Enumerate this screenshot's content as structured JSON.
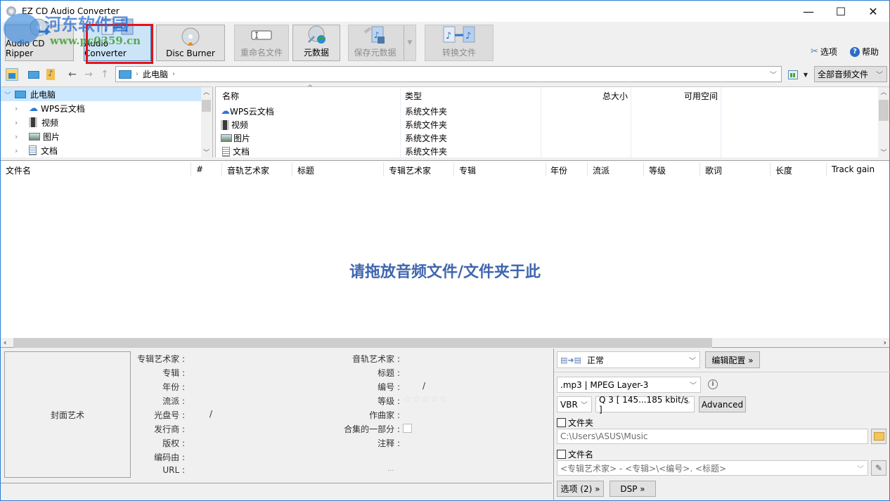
{
  "window": {
    "title": "EZ CD Audio Converter",
    "controls": {
      "minimize": "—",
      "maximize": "☐",
      "close": "✕"
    }
  },
  "watermark": {
    "text": "河东软件园",
    "url": "www.pc0359.cn"
  },
  "ribbon": {
    "buttons": [
      {
        "label": "Audio CD Ripper",
        "icon": "cd-ripper-icon",
        "state": "normal"
      },
      {
        "label": "Audio Converter",
        "icon": "audio-converter-icon",
        "state": "active"
      },
      {
        "label": "Disc Burner",
        "icon": "disc-burner-icon",
        "state": "normal"
      },
      {
        "label": "重命名文件",
        "icon": "rename-icon",
        "state": "disabled"
      },
      {
        "label": "元数据",
        "icon": "metadata-icon",
        "state": "normal"
      },
      {
        "label": "保存元数据",
        "icon": "save-metadata-icon",
        "state": "disabled"
      },
      {
        "label": "转换文件",
        "icon": "convert-icon",
        "state": "disabled"
      }
    ],
    "options_label": "选项",
    "help_label": "帮助"
  },
  "navbar": {
    "breadcrumb": [
      "此电脑"
    ],
    "filter": "全部音频文件"
  },
  "tree": {
    "items": [
      {
        "label": "此电脑",
        "icon": "computer-icon",
        "expanded": true,
        "selected": true
      },
      {
        "label": "WPS云文档",
        "icon": "cloud-icon"
      },
      {
        "label": "视频",
        "icon": "video-icon"
      },
      {
        "label": "图片",
        "icon": "picture-icon"
      },
      {
        "label": "文档",
        "icon": "document-icon"
      }
    ]
  },
  "file_list": {
    "headers": [
      "名称",
      "类型",
      "总大小",
      "可用空间"
    ],
    "rows": [
      {
        "name": "WPS云文档",
        "icon": "cloud-icon",
        "type": "系统文件夹"
      },
      {
        "name": "视频",
        "icon": "video-icon",
        "type": "系统文件夹"
      },
      {
        "name": "图片",
        "icon": "picture-icon",
        "type": "系统文件夹"
      },
      {
        "name": "文档",
        "icon": "document-icon",
        "type": "系统文件夹"
      }
    ]
  },
  "tracks": {
    "headers": [
      "文件名",
      "#",
      "音轨艺术家",
      "标题",
      "专辑艺术家",
      "专辑",
      "年份",
      "流派",
      "等级",
      "歌词",
      "长度",
      "Track gain"
    ],
    "drop_hint": "请拖放音频文件/文件夹于此"
  },
  "metadata": {
    "cover_label": "封面艺术",
    "left_fields": [
      {
        "label": "专辑艺术家 :",
        "value": ""
      },
      {
        "label": "专辑 :",
        "value": ""
      },
      {
        "label": "年份 :",
        "value": ""
      },
      {
        "label": "流派 :",
        "value": ""
      },
      {
        "label": "光盘号 :",
        "value": "/"
      },
      {
        "label": "发行商 :",
        "value": ""
      },
      {
        "label": "版权 :",
        "value": ""
      },
      {
        "label": "编码由 :",
        "value": ""
      },
      {
        "label": "URL :",
        "value": ""
      }
    ],
    "right_fields": [
      {
        "label": "音轨艺术家 :",
        "value": ""
      },
      {
        "label": "标题 :",
        "value": ""
      },
      {
        "label": "编号 :",
        "value": "/"
      },
      {
        "label": "等级 :",
        "value": "☆☆☆☆☆"
      },
      {
        "label": "作曲家 :",
        "value": ""
      },
      {
        "label": "合集的一部分 :",
        "value": ""
      },
      {
        "label": "注释 :",
        "value": ""
      }
    ],
    "rating": 0,
    "more": "..."
  },
  "converter": {
    "profile": "正常",
    "edit_profile": "编辑配置 »",
    "format": ".mp3 | MPEG Layer-3",
    "mode": "VBR",
    "quality": "Q 3  [ 145...185 kbit/s ]",
    "advanced": "Advanced",
    "folder_label": "文件夹",
    "folder_checked": false,
    "folder_path": "C:\\Users\\ASUS\\Music",
    "filename_label": "文件名",
    "filename_checked": false,
    "filename_pattern": "<专辑艺术家> - <专辑>\\<编号>. <标题>",
    "options_button": "选项 (2) »",
    "dsp_button": "DSP »"
  }
}
